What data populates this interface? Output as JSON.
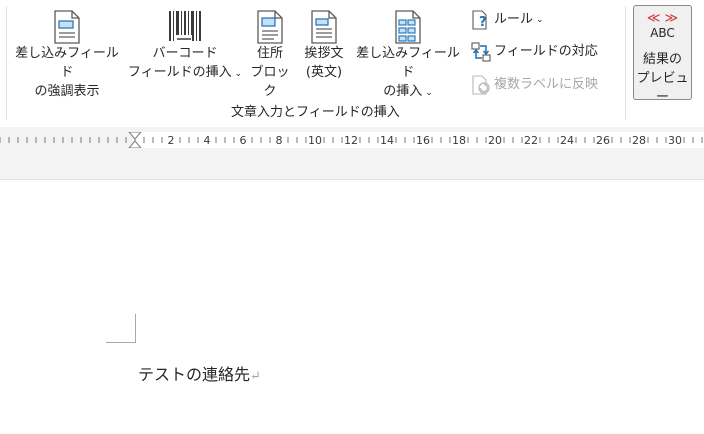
{
  "ribbon": {
    "highlight_merge_fields": {
      "line1": "差し込みフィールド",
      "line2": "の強調表示"
    },
    "barcode_field": {
      "line1": "バーコード",
      "line2": "フィールドの挿入"
    },
    "address_block": {
      "line1": "住所",
      "line2": "ブロック"
    },
    "greeting_line": {
      "line1": "挨拶文",
      "line2": "(英文)"
    },
    "insert_merge_field": {
      "line1": "差し込みフィールド",
      "line2": "の挿入"
    },
    "rules_label": "ルール",
    "match_fields_label": "フィールドの対応",
    "update_labels_label": "複数ラベルに反映",
    "group_label": "文章入力とフィールドの挿入",
    "preview_results": {
      "icon_text": "ABC",
      "line1": "結果の",
      "line2": "プレビュー"
    },
    "chevron": "⌄"
  },
  "ruler": {
    "labels": [
      "2",
      "4",
      "6",
      "8",
      "10",
      "12",
      "14",
      "16",
      "18",
      "20",
      "22",
      "24",
      "26",
      "28",
      "30"
    ]
  },
  "document": {
    "text": "テストの連絡先",
    "paragraph_mark": "↵"
  },
  "colors": {
    "accent_blue": "#1e6fb5",
    "preview_red": "#d13438",
    "disabled_gray": "#a6a6a6"
  }
}
